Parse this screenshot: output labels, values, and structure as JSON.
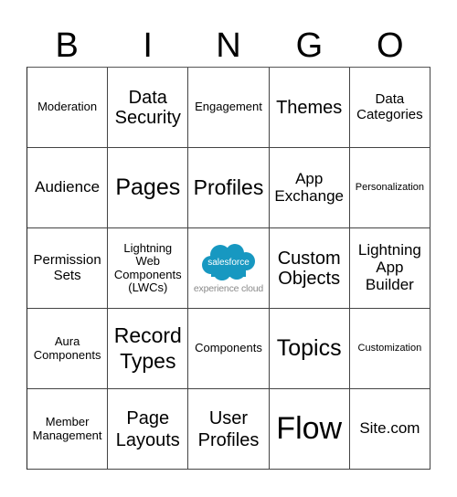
{
  "header": {
    "letters": [
      "B",
      "I",
      "N",
      "G",
      "O"
    ]
  },
  "center_logo": {
    "brand": "salesforce",
    "subtitle": "experience cloud",
    "brand_color": "#1798c1"
  },
  "rows": [
    [
      "Moderation",
      "Data Security",
      "Engagement",
      "Themes",
      "Data Categories"
    ],
    [
      "Audience",
      "Pages",
      "Profiles",
      "App Exchange",
      "Personalization"
    ],
    [
      "Permission Sets",
      "Lightning Web Components (LWCs)",
      "",
      "Custom Objects",
      "Lightning App Builder"
    ],
    [
      "Aura Components",
      "Record Types",
      "Components",
      "Topics",
      "Customization"
    ],
    [
      "Member Management",
      "Page Layouts",
      "User Profiles",
      "Flow",
      "Site.com"
    ]
  ]
}
